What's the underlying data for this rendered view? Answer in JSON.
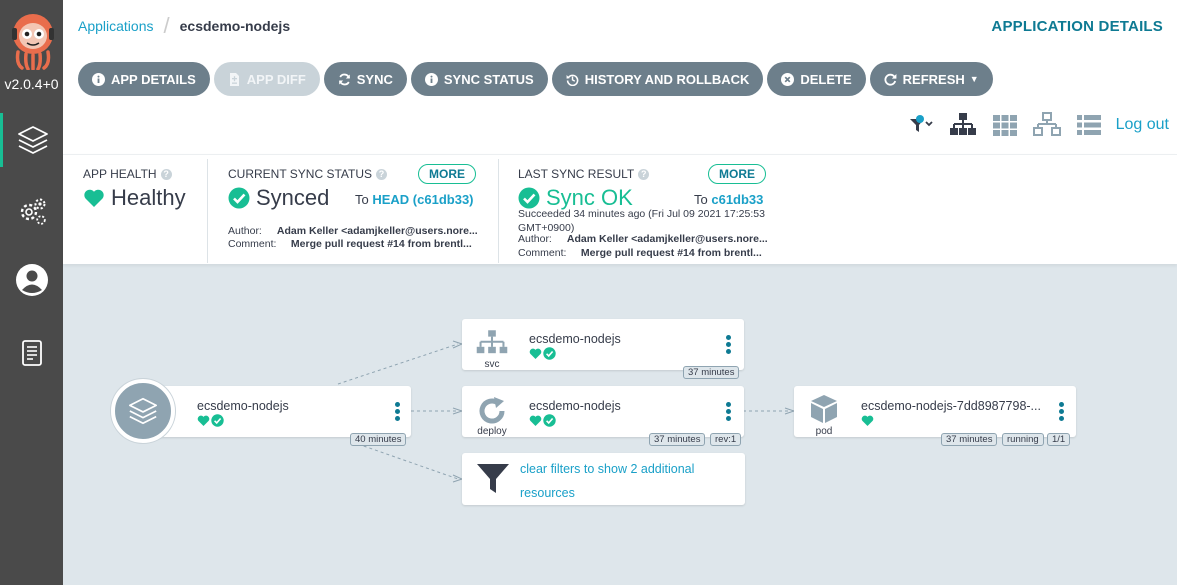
{
  "sidebar": {
    "version": "v2.0.4+0",
    "items": [
      {
        "name": "applications",
        "icon": "layers-icon"
      },
      {
        "name": "settings",
        "icon": "gears-icon"
      },
      {
        "name": "user-info",
        "icon": "user-icon"
      },
      {
        "name": "documentation",
        "icon": "book-icon"
      }
    ]
  },
  "topbar": {
    "breadcrumb_root": "Applications",
    "breadcrumb_current": "ecsdemo-nodejs",
    "title": "APPLICATION DETAILS"
  },
  "toolbar": {
    "buttons": [
      {
        "label": "APP DETAILS",
        "icon": "info-circle-icon"
      },
      {
        "label": "APP DIFF",
        "icon": "file-diff-icon"
      },
      {
        "label": "SYNC",
        "icon": "sync-icon"
      },
      {
        "label": "SYNC STATUS",
        "icon": "info-circle-icon"
      },
      {
        "label": "HISTORY AND ROLLBACK",
        "icon": "history-icon"
      },
      {
        "label": "DELETE",
        "icon": "times-circle-icon"
      },
      {
        "label": "REFRESH",
        "icon": "redo-icon"
      }
    ],
    "logout": "Log out"
  },
  "status": {
    "health": {
      "label": "APP HEALTH",
      "value": "Healthy"
    },
    "sync": {
      "label": "CURRENT SYNC STATUS",
      "more": "MORE",
      "value": "Synced",
      "to_prefix": "To",
      "to_rev": "HEAD (c61db33)",
      "author_label": "Author:",
      "author": "Adam Keller <adamjkeller@users.nore...",
      "comment_label": "Comment:",
      "comment": "Merge pull request #14 from brentl..."
    },
    "last_sync": {
      "label": "LAST SYNC RESULT",
      "more": "MORE",
      "value": "Sync OK",
      "to_prefix": "To",
      "to_rev": "c61db33",
      "succeeded": "Succeeded 34 minutes ago (Fri Jul 09 2021 17:25:53 GMT+0900)",
      "author_label": "Author:",
      "author": "Adam Keller <adamjkeller@users.nore...",
      "comment_label": "Comment:",
      "comment": "Merge pull request #14 from brentl..."
    }
  },
  "graph": {
    "app": {
      "name": "ecsdemo-nodejs",
      "age": "40 minutes"
    },
    "svc": {
      "name": "ecsdemo-nodejs",
      "kind": "svc",
      "age": "37 minutes"
    },
    "deploy": {
      "name": "ecsdemo-nodejs",
      "kind": "deploy",
      "age": "37 minutes",
      "rev": "rev:1"
    },
    "pod": {
      "name": "ecsdemo-nodejs-7dd8987798-...",
      "kind": "pod",
      "age": "37 minutes",
      "state": "running",
      "ready": "1/1"
    },
    "filter_message": "clear filters to show 2 additional resources"
  },
  "colors": {
    "accent": "#18be94",
    "link": "#1aa0c8",
    "button": "#6d7f8b",
    "sidebar": "#4a4a4a",
    "canvas": "#dee6eb"
  }
}
